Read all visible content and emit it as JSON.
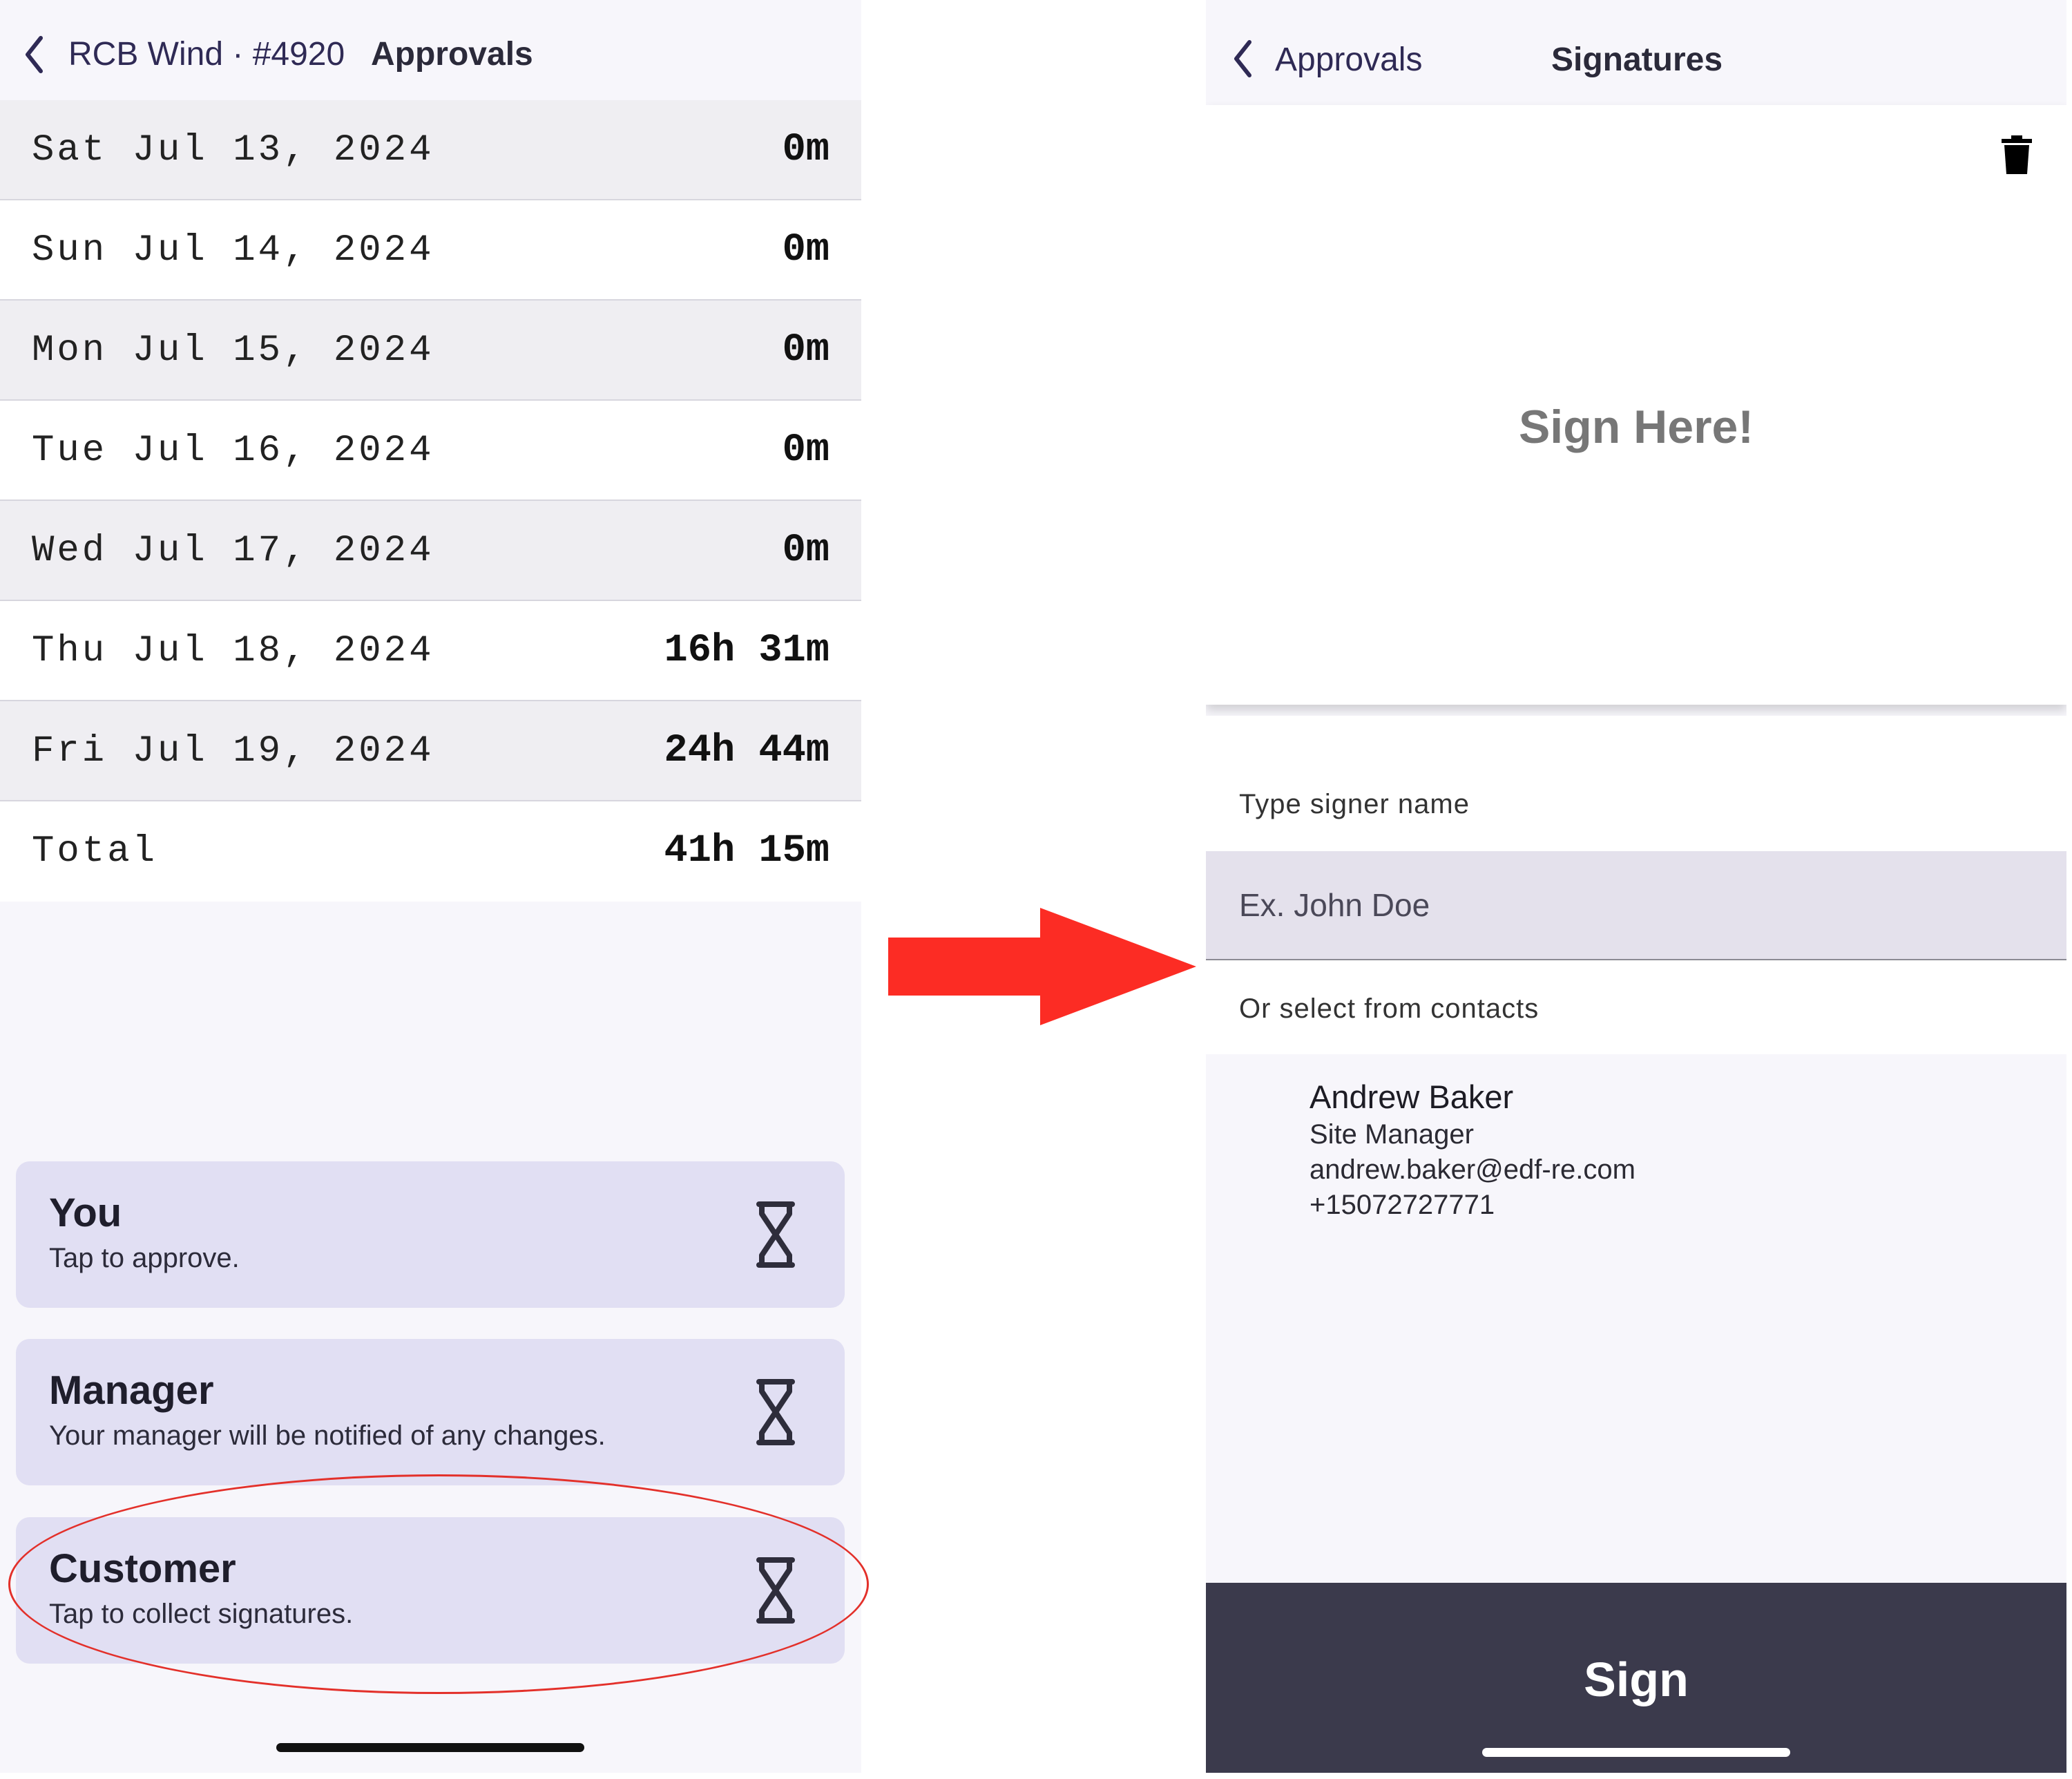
{
  "left_screen": {
    "nav": {
      "back_label": "RCB Wind · #4920",
      "title": "Approvals"
    },
    "rows": [
      {
        "date": "Sat Jul 13, 2024",
        "duration": "0m"
      },
      {
        "date": "Sun Jul 14, 2024",
        "duration": "0m"
      },
      {
        "date": "Mon Jul 15, 2024",
        "duration": "0m"
      },
      {
        "date": "Tue Jul 16, 2024",
        "duration": "0m"
      },
      {
        "date": "Wed Jul 17, 2024",
        "duration": "0m"
      },
      {
        "date": "Thu Jul 18, 2024",
        "duration": "16h 31m"
      },
      {
        "date": "Fri Jul 19, 2024",
        "duration": "24h 44m"
      }
    ],
    "total": {
      "label": "Total",
      "duration": "41h 15m"
    },
    "approvers": [
      {
        "title": "You",
        "subtitle": "Tap to approve.",
        "icon": "hourglass-icon"
      },
      {
        "title": "Manager",
        "subtitle": "Your manager will be notified of any changes.",
        "icon": "hourglass-icon"
      },
      {
        "title": "Customer",
        "subtitle": "Tap to collect signatures.",
        "icon": "hourglass-icon"
      }
    ]
  },
  "right_screen": {
    "nav": {
      "back_label": "Approvals",
      "title": "Signatures"
    },
    "signature_pad": {
      "hint": "Sign Here!",
      "clear_icon": "trash-icon"
    },
    "signer": {
      "label": "Type signer name",
      "placeholder": "Ex. John Doe",
      "contacts_label": "Or select from contacts"
    },
    "contact": {
      "name": "Andrew Baker",
      "role": "Site Manager",
      "email": "andrew.baker@edf-re.com",
      "phone": "+15072727771"
    },
    "sign_button": "Sign"
  },
  "colors": {
    "accent_nav": "#2f2a55",
    "card_bg": "#e1dff3",
    "sign_button_bg": "#3b3a4c",
    "annotation_red": "#e3302a"
  }
}
